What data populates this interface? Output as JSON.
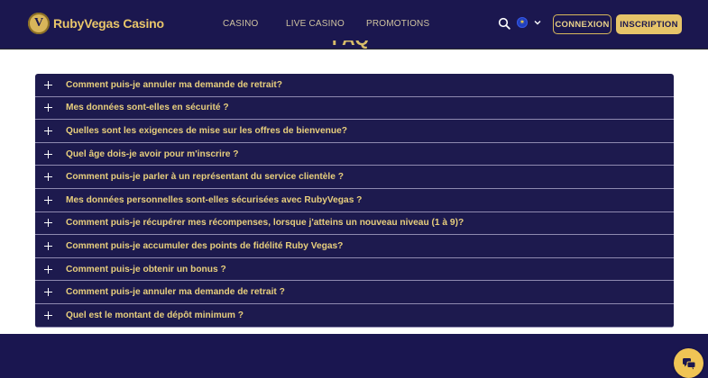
{
  "brand": {
    "name": "RubyVegas Casino",
    "mark": "V"
  },
  "nav": {
    "casino": "CASINO",
    "live": "LIVE CASINO",
    "promotions": "PROMOTIONS"
  },
  "icons": {
    "search": "search-icon",
    "language": "flag-icon",
    "chevron": "chevron-down-icon",
    "chat": "chat-icon",
    "expand": "plus-icon"
  },
  "buttons": {
    "login": "CONNEXION",
    "register": "INSCRIPTION"
  },
  "faq": {
    "title_fragment": "FAQ",
    "items": [
      "Comment puis-je annuler ma demande de retrait?",
      "Mes données sont-elles en sécurité ?",
      "Quelles sont les exigences de mise sur les offres de bienvenue?",
      "Quel âge dois-je avoir pour m'inscrire ?",
      "Comment puis-je parler à un représentant du service clientèle ?",
      "Mes données personnelles sont-elles sécurisées avec RubyVegas ?",
      "Comment puis-je récupérer mes récompenses, lorsque j'atteins un nouveau niveau (1 à 9)?",
      "Comment puis-je accumuler des points de fidélité Ruby Vegas?",
      "Comment puis-je obtenir un bonus ?",
      "Comment puis-je annuler ma demande de retrait ?",
      "Quel est le montant de dépôt minimum ?"
    ]
  },
  "colors": {
    "header_bg": "#1b174f",
    "gold": "#e6c469",
    "faq_text": "#e8cf7d",
    "faq_bg": "#1d1a4e"
  }
}
